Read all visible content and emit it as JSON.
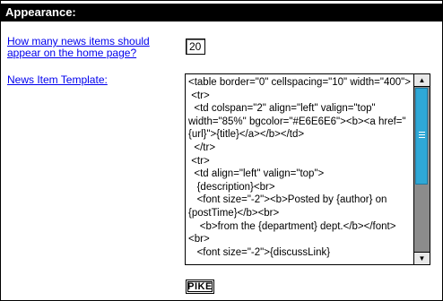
{
  "section": {
    "title": "Appearance:"
  },
  "news_items": {
    "question": "How many news items should appear on the home page?",
    "value": "20"
  },
  "template": {
    "label": "News Item Template:",
    "value": "<table border=\"0\" cellspacing=\"10\" width=\"400\">\n <tr>\n  <td colspan=\"2\" align=\"left\" valign=\"top\" width=\"85%\" bgcolor=\"#E6E6E6\"><b><a href=\"{url}\">{title}</a></b></td>\n  </tr>\n <tr>\n  <td align=\"left\" valign=\"top\">\n   {description}<br>\n   <font size=\"-2\"><b>Posted by {author} on {postTime}</b><br>\n    <b>from the {department} dept.</b></font><br>\n   <font size=\"-2\">{discussLink}",
    "scroll_position": 0.0
  },
  "footer": {
    "logo_text": "PIKE"
  },
  "colors": {
    "header_bg": "#000000",
    "link": "#0000ee",
    "scroll_thumb": "#2fa8d6",
    "scroll_track": "#8c8c8c"
  }
}
